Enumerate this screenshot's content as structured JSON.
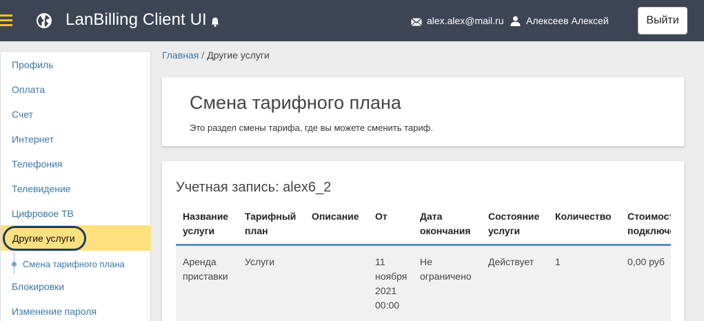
{
  "header": {
    "title": "LanBilling Client UI",
    "email": "alex.alex@mail.ru",
    "username": "Алексеев Алексей",
    "logout_label": "Выйти"
  },
  "sidebar": {
    "items": [
      {
        "label": "Профиль"
      },
      {
        "label": "Оплата"
      },
      {
        "label": "Счет"
      },
      {
        "label": "Интернет"
      },
      {
        "label": "Телефония"
      },
      {
        "label": "Телевидение"
      },
      {
        "label": "Цифровое ТВ"
      },
      {
        "label": "Другие услуги"
      },
      {
        "label": "Блокировки"
      },
      {
        "label": "Изменение пароля"
      }
    ],
    "active_index": 7,
    "subitem": "Смена тарифного плана"
  },
  "breadcrumb": {
    "home": "Главная",
    "separator": "/",
    "current": "Другие услуги"
  },
  "page": {
    "title": "Смена тарифного плана",
    "description": "Это раздел смены тарифа, где вы можете сменить тариф."
  },
  "account": {
    "title": "Учетная запись: alex6_2"
  },
  "table": {
    "headers": [
      "Название услуги",
      "Тарифный план",
      "Описание",
      "От",
      "Дата окончания",
      "Состояние услуги",
      "Количество",
      "Стоимость подключения"
    ],
    "rows": [
      [
        "Аренда приставки",
        "Услуги",
        "",
        "11 ноября 2021 00:00",
        "Не ограничено",
        "Действует",
        "1",
        "0,00 руб"
      ]
    ]
  },
  "colors": {
    "topbar": "#3d4555",
    "accent": "#f2c218",
    "active_bg": "#fee07e",
    "link": "#3a78a8",
    "table_header_border": "#5b8ebf"
  }
}
